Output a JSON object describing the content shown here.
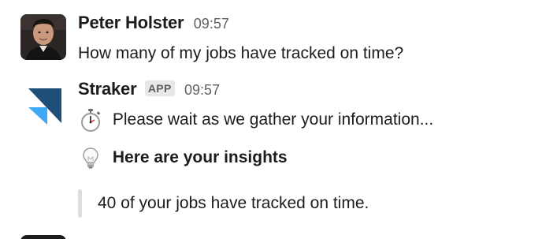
{
  "messages": [
    {
      "sender": "Peter Holster",
      "time": "09:57",
      "text": "How many of my jobs have tracked on time?"
    },
    {
      "sender": "Straker",
      "badge": "APP",
      "time": "09:57",
      "lines": [
        {
          "icon": "stopwatch-icon",
          "text": "Please wait as we gather your information..."
        },
        {
          "icon": "lightbulb-icon",
          "text": "Here are your insights"
        }
      ],
      "quote": "40 of your jobs have tracked on time."
    }
  ],
  "colors": {
    "text": "#1d1c1d",
    "muted": "#616061",
    "badge_bg": "#e8e8e8",
    "quote_bar": "#dddddd",
    "straker_dark_blue": "#1f4e79",
    "straker_light_blue": "#3fa9f5"
  }
}
